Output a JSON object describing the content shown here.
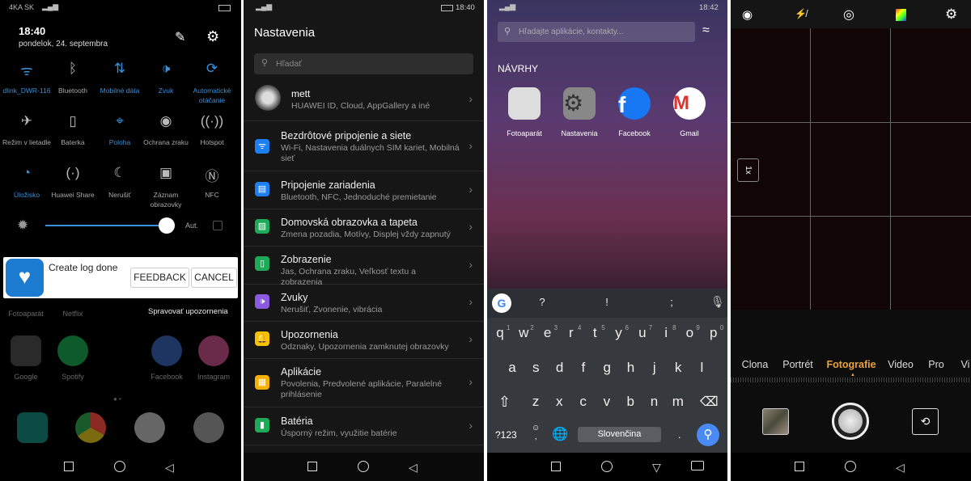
{
  "panel1": {
    "status": {
      "carrier": "4KA SK"
    },
    "time": "18:40",
    "date": "pondelok, 24. septembra",
    "tiles": [
      {
        "label": "dlink_DWR-116",
        "icon": "wifi-icon",
        "on": true
      },
      {
        "label": "Bluetooth",
        "icon": "bluetooth-icon",
        "on": false
      },
      {
        "label": "Mobilné dáta",
        "icon": "mobile-data-icon",
        "on": true
      },
      {
        "label": "Zvuk",
        "icon": "sound-icon",
        "on": true
      },
      {
        "label": "Automatické otáčanie",
        "icon": "auto-rotate-icon",
        "on": true
      },
      {
        "label": "Režim v lietadle",
        "icon": "airplane-icon",
        "on": false
      },
      {
        "label": "Baterka",
        "icon": "flashlight-icon",
        "on": false
      },
      {
        "label": "Poloha",
        "icon": "location-icon",
        "on": true
      },
      {
        "label": "Ochrana zraku",
        "icon": "eye-icon",
        "on": false
      },
      {
        "label": "Hotspot",
        "icon": "hotspot-icon",
        "on": false
      },
      {
        "label": "Úložisko",
        "icon": "storage-icon",
        "on": true
      },
      {
        "label": "Huawei Share",
        "icon": "share-icon",
        "on": false
      },
      {
        "label": "Nerušiť",
        "icon": "moon-icon",
        "on": false
      },
      {
        "label": "Záznam obrazovky",
        "icon": "screen-record-icon",
        "on": false
      },
      {
        "label": "NFC",
        "icon": "nfc-icon",
        "on": false
      }
    ],
    "brightness": {
      "level": 0.95,
      "auto_label": "Aut.",
      "auto": false
    },
    "notification": {
      "text": "Create log done",
      "feedback": "FEEDBACK",
      "cancel": "CANCEL"
    },
    "manage_notifications": "Spravovať upozornenia",
    "home_apps_row1": [
      "Fotoaparát",
      "Netflix"
    ],
    "home_apps_row2": [
      "Google",
      "Spotify",
      "Facebook",
      "Instagram"
    ]
  },
  "panel2": {
    "time": "18:40",
    "title": "Nastavenia",
    "search_placeholder": "Hľadať",
    "account": {
      "name": "mett",
      "desc": "HUAWEI ID, Cloud, AppGallery a iné"
    },
    "items": [
      {
        "title": "Bezdrôtové pripojenie a siete",
        "desc": "Wi-Fi, Nastavenia duálnych SIM kariet, Mobilná sieť",
        "color": "#1e7ff0",
        "icon": "wifi-icon"
      },
      {
        "title": "Pripojenie zariadenia",
        "desc": "Bluetooth, NFC, Jednoduché premietanie",
        "color": "#1e7ff0",
        "icon": "devices-icon"
      },
      {
        "title": "Domovská obrazovka a tapeta",
        "desc": "Zmena pozadia, Motívy, Displej vždy zapnutý",
        "color": "#1faa5a",
        "icon": "wallpaper-icon"
      },
      {
        "title": "Zobrazenie",
        "desc": "Jas, Ochrana zraku, Veľkosť textu a zobrazenia",
        "color": "#1faa5a",
        "icon": "display-icon"
      },
      {
        "title": "Zvuky",
        "desc": "Nerušiť, Zvonenie, vibrácia",
        "color": "#8a5ae0",
        "icon": "sound-icon"
      },
      {
        "title": "Upozornenia",
        "desc": "Odznaky, Upozornenia zamknutej obrazovky",
        "color": "#f5c000",
        "icon": "bell-icon"
      },
      {
        "title": "Aplikácie",
        "desc": "Povolenia, Predvolené aplikácie, Paralelné prihlásenie",
        "color": "#f5b000",
        "icon": "apps-icon"
      },
      {
        "title": "Batéria",
        "desc": "Úsporný režim, využitie batérie",
        "color": "#1faa5a",
        "icon": "battery-icon"
      }
    ]
  },
  "panel3": {
    "time": "18:42",
    "search_placeholder": "Hľadajte aplikácie, kontakty...",
    "suggestions_title": "NÁVRHY",
    "apps": [
      "Fotoaparát",
      "Nastavenia",
      "Facebook",
      "Gmail"
    ],
    "keyboard": {
      "suggestions": [
        "?",
        "!",
        ";"
      ],
      "row1": [
        "q",
        "w",
        "e",
        "r",
        "t",
        "y",
        "u",
        "i",
        "o",
        "p"
      ],
      "row1_hints": [
        "1",
        "2",
        "3",
        "4",
        "5",
        "6",
        "7",
        "8",
        "9",
        "0"
      ],
      "row2": [
        "a",
        "s",
        "d",
        "f",
        "g",
        "h",
        "j",
        "k",
        "l"
      ],
      "row3": [
        "z",
        "x",
        "c",
        "v",
        "b",
        "n",
        "m"
      ],
      "symbols": "?123",
      "space": "Slovenčina",
      "period": ".",
      "comma": ","
    }
  },
  "panel4": {
    "zoom": "1x",
    "modes": [
      "Clona",
      "Portrét",
      "Fotografie",
      "Video",
      "Pro",
      "Vi"
    ],
    "active_mode": "Fotografie",
    "accent": "#e8a33a"
  }
}
